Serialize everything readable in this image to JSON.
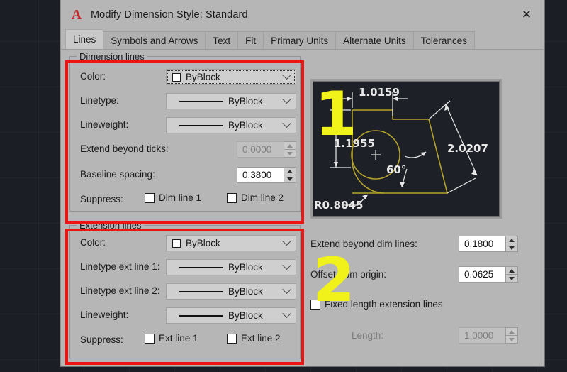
{
  "window": {
    "title": "Modify Dimension Style: Standard",
    "logo_glyph": "A",
    "close_glyph": "✕"
  },
  "tabs": [
    {
      "label": "Lines",
      "active": true
    },
    {
      "label": "Symbols and Arrows",
      "active": false
    },
    {
      "label": "Text",
      "active": false
    },
    {
      "label": "Fit",
      "active": false
    },
    {
      "label": "Primary Units",
      "active": false
    },
    {
      "label": "Alternate Units",
      "active": false
    },
    {
      "label": "Tolerances",
      "active": false
    }
  ],
  "dimension_lines": {
    "group_title": "Dimension lines",
    "color_label": "Color:",
    "color_value": "ByBlock",
    "linetype_label": "Linetype:",
    "linetype_value": "ByBlock",
    "lineweight_label": "Lineweight:",
    "lineweight_value": "ByBlock",
    "extend_beyond_ticks_label": "Extend beyond ticks:",
    "extend_beyond_ticks_value": "0.0000",
    "baseline_spacing_label": "Baseline spacing:",
    "baseline_spacing_value": "0.3800",
    "suppress_label": "Suppress:",
    "suppress_1": "Dim line 1",
    "suppress_2": "Dim line 2"
  },
  "extension_lines": {
    "group_title": "Extension lines",
    "color_label": "Color:",
    "color_value": "ByBlock",
    "linetype_ext1_label": "Linetype ext line 1:",
    "linetype_ext1_value": "ByBlock",
    "linetype_ext2_label": "Linetype ext line 2:",
    "linetype_ext2_value": "ByBlock",
    "lineweight_label": "Lineweight:",
    "lineweight_value": "ByBlock",
    "suppress_label": "Suppress:",
    "suppress_1": "Ext line 1",
    "suppress_2": "Ext line 2",
    "extend_beyond_dim_label": "Extend beyond dim lines:",
    "extend_beyond_dim_value": "0.1800",
    "offset_from_origin_label": "Offset from origin:",
    "offset_from_origin_value": "0.0625",
    "fixed_length_label": "Fixed length extension lines",
    "length_label": "Length:",
    "length_value": "1.0000"
  },
  "preview": {
    "dim_top": "1.0159",
    "dim_left": "1.1955",
    "dim_right": "2.0207",
    "dim_angle": "60°",
    "dim_radius": "R0.8045",
    "geometry_color": "#b5a22a",
    "annotation_color": "#e8e8e8",
    "background_color": "#1d2027"
  },
  "annotations": {
    "marker_one": "1",
    "marker_two": "2",
    "highlight_color": "#ef1414",
    "marker_color": "#f2f21b"
  }
}
